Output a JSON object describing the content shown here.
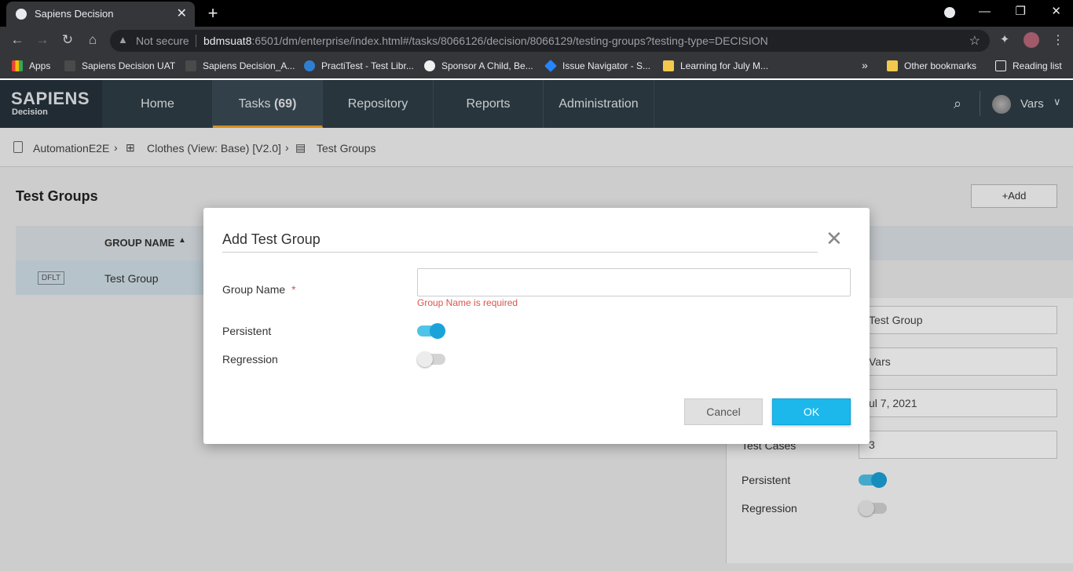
{
  "browser": {
    "tab_title": "Sapiens Decision",
    "not_secure": "Not secure",
    "url_host": "bdmsuat8",
    "url_rest": ":6501/dm/enterprise/index.html#/tasks/8066126/decision/8066129/testing-groups?testing-type=DECISION",
    "bookmarks": [
      "Apps",
      "Sapiens Decision UAT",
      "Sapiens Decision_A...",
      "PractiTest - Test Libr...",
      "Sponsor A Child, Be...",
      "Issue Navigator - S...",
      "Learning for July M..."
    ],
    "other_bookmarks": "Other bookmarks",
    "reading_list": "Reading list",
    "more": "»"
  },
  "app": {
    "logo_main": "SAPIENS",
    "logo_sub": "Decision",
    "nav": {
      "home": "Home",
      "tasks": "Tasks",
      "tasks_count": "(69)",
      "repository": "Repository",
      "reports": "Reports",
      "administration": "Administration"
    },
    "user": "Vars"
  },
  "breadcrumb": {
    "project": "AutomationE2E",
    "model": "Clothes (View: Base) [V2.0]",
    "page": "Test Groups"
  },
  "page": {
    "title": "Test Groups",
    "add_button": "+Add",
    "column_group_name": "GROUP NAME",
    "rows": [
      {
        "badge": "DFLT",
        "name": "Test Group"
      }
    ]
  },
  "details": {
    "name_value": "Test Group",
    "owner_value": "Vars",
    "date_value": "ul 7, 2021",
    "test_cases_label": "Test Cases",
    "test_cases_value": "3",
    "persistent_label": "Persistent",
    "persistent_on": true,
    "regression_label": "Regression",
    "regression_on": false
  },
  "modal": {
    "title": "Add Test Group",
    "group_name_label": "Group Name",
    "required_mark": "*",
    "group_name_value": "",
    "group_name_error": "Group Name is required",
    "persistent_label": "Persistent",
    "persistent_on": true,
    "regression_label": "Regression",
    "regression_on": false,
    "cancel": "Cancel",
    "ok": "OK"
  },
  "colors": {
    "accent": "#1cb8ec",
    "header": "#2f3d47",
    "active_tab_underline": "#f0a623",
    "error": "#d9534f"
  }
}
